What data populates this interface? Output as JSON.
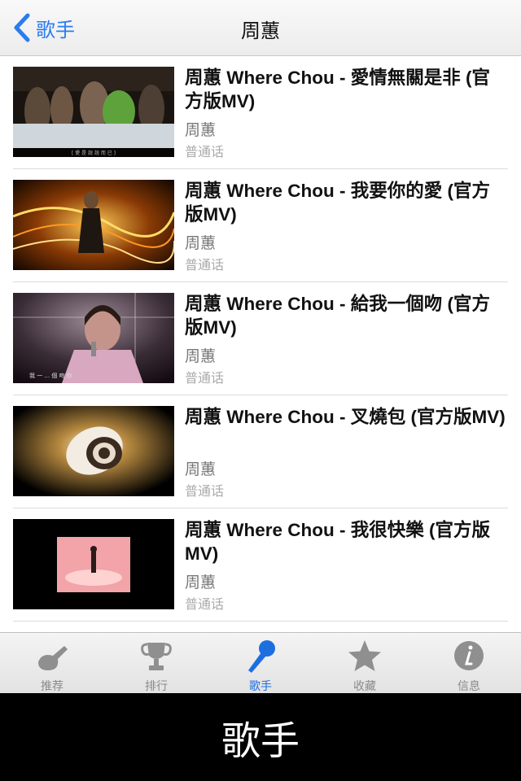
{
  "navbar": {
    "back_label": "歌手",
    "title": "周蕙"
  },
  "videos": [
    {
      "title": "周蕙 Where Chou - 愛情無關是非 (官方版MV)",
      "artist": "周蕙",
      "language": "普通话",
      "caption": "[ 愛 是 說 說 而 已 ]"
    },
    {
      "title": "周蕙 Where Chou - 我要你的愛 (官方版MV)",
      "artist": "周蕙",
      "language": "普通话"
    },
    {
      "title": "周蕙 Where Chou - 給我一個吻 (官方版MV)",
      "artist": "周蕙",
      "language": "普通话",
      "caption": "我 一 ... 個 吻 你"
    },
    {
      "title": "周蕙 Where Chou - 叉燒包 (官方版MV)",
      "artist": "周蕙",
      "language": "普通话"
    },
    {
      "title": "周蕙 Where Chou - 我很快樂 (官方版MV)",
      "artist": "周蕙",
      "language": "普通话"
    }
  ],
  "tabs": [
    {
      "label": "推荐",
      "icon": "guitar-icon"
    },
    {
      "label": "排行",
      "icon": "trophy-icon"
    },
    {
      "label": "歌手",
      "icon": "microphone-icon",
      "active": true
    },
    {
      "label": "收藏",
      "icon": "star-icon"
    },
    {
      "label": "信息",
      "icon": "info-icon"
    }
  ],
  "banner": {
    "text": "歌手"
  },
  "colors": {
    "accent": "#2a7cf0",
    "tab_active": "#1d6fe0",
    "tab_inactive": "#8a8a8a"
  }
}
